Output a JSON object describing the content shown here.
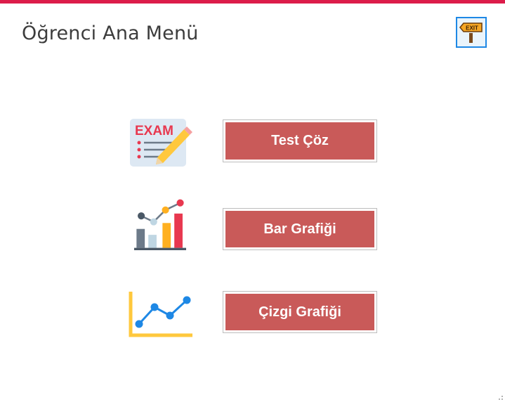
{
  "window": {
    "accent_color": "#dc1c4a"
  },
  "header": {
    "title": "Öğrenci Ana Menü"
  },
  "exit": {
    "icon": "exit-sign-icon",
    "sign_text": "EXIT"
  },
  "menu": {
    "button_color": "#c95a59",
    "items": [
      {
        "label": "Test Çöz",
        "icon": "exam-icon",
        "icon_text": "EXAM"
      },
      {
        "label": "Bar Grafiği",
        "icon": "bar-chart-icon"
      },
      {
        "label": "Çizgi Grafiği",
        "icon": "line-chart-icon"
      }
    ]
  }
}
